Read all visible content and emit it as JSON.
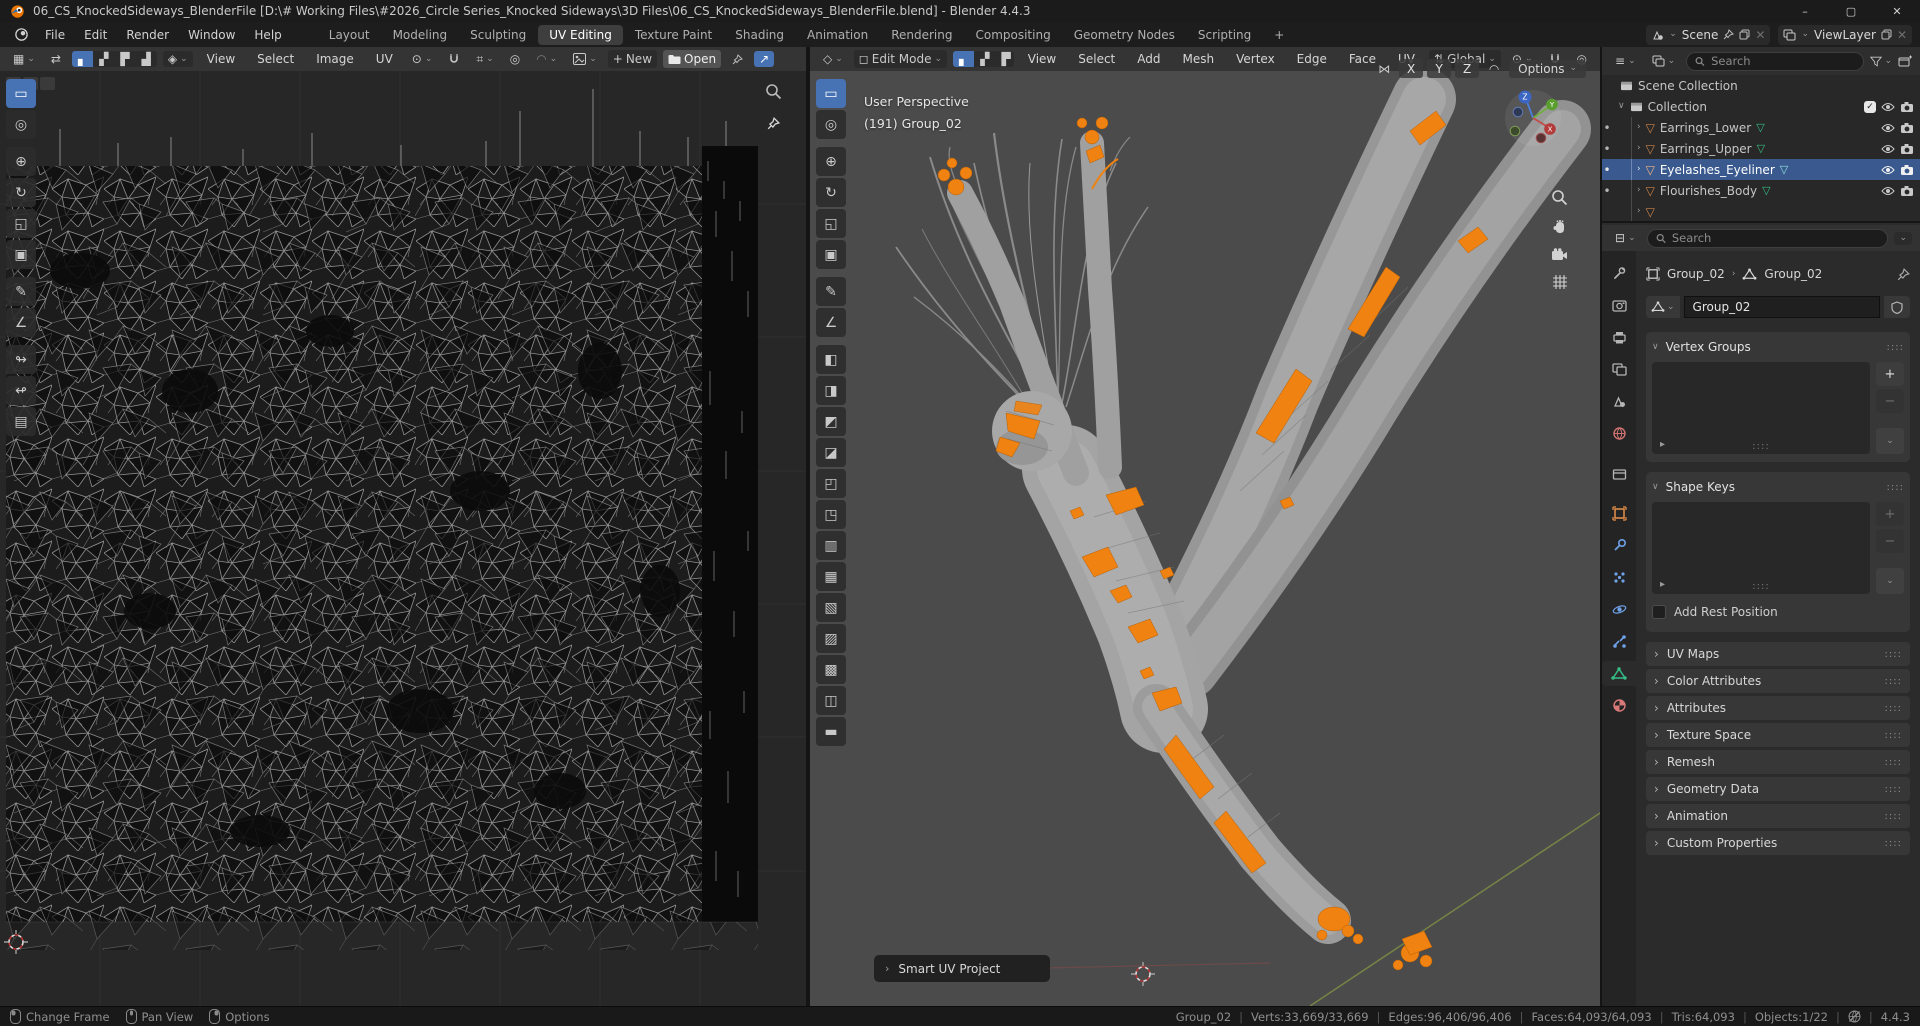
{
  "window": {
    "title": "06_CS_KnockedSideways_BlenderFile [D:\\# Working Files\\#2026_Circle Series_Knocked Sideways\\3D Files\\06_CS_KnockedSideways_BlenderFile.blend] - Blender 4.4.3"
  },
  "colors": {
    "accent_blue": "#4772b3",
    "selection_blue": "#3a5a8f",
    "blender_orange": "#ea7600",
    "selected_uv_orange": "#ef8210"
  },
  "menubar": {
    "menus": [
      "File",
      "Edit",
      "Render",
      "Window",
      "Help"
    ]
  },
  "workspaces": {
    "tabs": [
      "Layout",
      "Modeling",
      "Sculpting",
      "UV Editing",
      "Texture Paint",
      "Shading",
      "Animation",
      "Rendering",
      "Compositing",
      "Geometry Nodes",
      "Scripting"
    ],
    "active": "UV Editing",
    "add_label": "+"
  },
  "scene_selector": {
    "scene": "Scene",
    "view_layer": "ViewLayer"
  },
  "uv_editor": {
    "menus": [
      "View",
      "Select",
      "Image",
      "UV"
    ],
    "new_label": "New",
    "open_label": "Open",
    "toolbar_icons": [
      "▭",
      "◎",
      "⊕",
      "↻",
      "◱",
      "▣",
      "✎",
      "∠",
      "↬",
      "↫",
      "▤"
    ]
  },
  "viewport": {
    "mode": "Edit Mode",
    "menus": [
      "View",
      "Select",
      "Add",
      "Mesh",
      "Vertex",
      "Edge",
      "Face",
      "UV"
    ],
    "orientation": "Global",
    "axes": [
      "X",
      "Y",
      "Z"
    ],
    "options_label": "Options",
    "overlay": {
      "line1": "User Perspective",
      "line2": "(191) Group_02"
    },
    "operator": "Smart UV Project",
    "gizmo_axes": [
      "X",
      "Y",
      "Z"
    ],
    "toolbar_icons": [
      "▭",
      "◎",
      "⊕",
      "↻",
      "◱",
      "▣",
      "✎",
      "∠",
      "◧",
      "◨",
      "◩",
      "◪",
      "◰",
      "◳",
      "▥",
      "▦",
      "▧",
      "▨",
      "▩",
      "◫",
      "▬"
    ]
  },
  "outliner": {
    "search_placeholder": "Search",
    "scene_collection": "Scene Collection",
    "collection": "Collection",
    "items": [
      {
        "label": "Earrings_Lower",
        "selected": false
      },
      {
        "label": "Earrings_Upper",
        "selected": false
      },
      {
        "label": "Eyelashes_Eyeliner",
        "selected": true
      },
      {
        "label": "Flourishes_Body",
        "selected": false
      }
    ]
  },
  "properties": {
    "search_placeholder": "Search",
    "breadcrumb": {
      "object": "Group_02",
      "data": "Group_02"
    },
    "name_value": "Group_02",
    "panels": {
      "vertex_groups": "Vertex Groups",
      "shape_keys": "Shape Keys",
      "add_rest_position": "Add Rest Position"
    },
    "collapsed": [
      "UV Maps",
      "Color Attributes",
      "Attributes",
      "Texture Space",
      "Remesh",
      "Geometry Data",
      "Animation",
      "Custom Properties"
    ]
  },
  "statusbar": {
    "hints": [
      "Change Frame",
      "Pan View",
      "Options"
    ],
    "stats": [
      "Group_02",
      "Verts:33,669/33,669",
      "Edges:96,406/96,406",
      "Faces:64,093/64,093",
      "Tris:64,093",
      "Objects:1/22"
    ],
    "version": "4.4.3"
  },
  "icons": {
    "chevron_down": "⌄",
    "chevron_right": "›",
    "expand_down": "∨",
    "grip": "::::",
    "play": "▸",
    "plus": "+",
    "minus": "−",
    "close": "✕",
    "minimize": "–",
    "maximize": "▢",
    "dot": "•",
    "sync": "⇄",
    "sticky": "◈",
    "pivot": "⊙",
    "orientation": "⇅",
    "prop_edit": "◎",
    "falloff": "◠",
    "mirror": "⋈",
    "mode": "◻",
    "snap_with": "⌗",
    "editor_uv": "▦",
    "editor_3d": "◇",
    "editor_outliner": "≡",
    "editor_props": "⊟",
    "diag_arrow": "↗",
    "folder": "▨"
  }
}
